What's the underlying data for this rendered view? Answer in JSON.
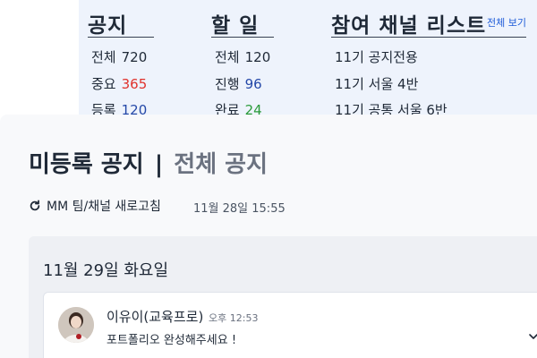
{
  "notices": {
    "title": "공지",
    "rows": [
      {
        "label": "전체",
        "value": "720"
      },
      {
        "label": "중요",
        "value": "365"
      },
      {
        "label": "등록",
        "value": "120"
      }
    ]
  },
  "todos": {
    "title": "할 일",
    "rows": [
      {
        "label": "전체",
        "value": "120"
      },
      {
        "label": "진행",
        "value": "96"
      },
      {
        "label": "완료",
        "value": "24"
      }
    ]
  },
  "channels": {
    "title": "참여 채널 리스트",
    "view_all": "전체 보기",
    "items": [
      "11기 공지전용",
      "11기 서울 4반",
      "11기 공통 서울 6반"
    ]
  },
  "page": {
    "title_active": "미등록 공지",
    "separator": "|",
    "title_inactive": "전체 공지"
  },
  "refresh": {
    "label": "MM 팀/채널 새로고침",
    "time": "11월 28일 15:55"
  },
  "feed": {
    "day": "11월 29일 화요일",
    "message": {
      "sender": "이유이(교육프로)",
      "time": "오후 12:53",
      "text": "포트폴리오 완성해주세요 !"
    }
  },
  "colors": {
    "panel_bg": "#eef3fc",
    "accent_red": "#e0322c",
    "accent_blue": "#2448a8",
    "accent_green": "#2a9a3a",
    "link": "#1d5bd8"
  },
  "icons": {
    "refresh": "refresh-icon",
    "expand": "chevron-down-icon"
  }
}
